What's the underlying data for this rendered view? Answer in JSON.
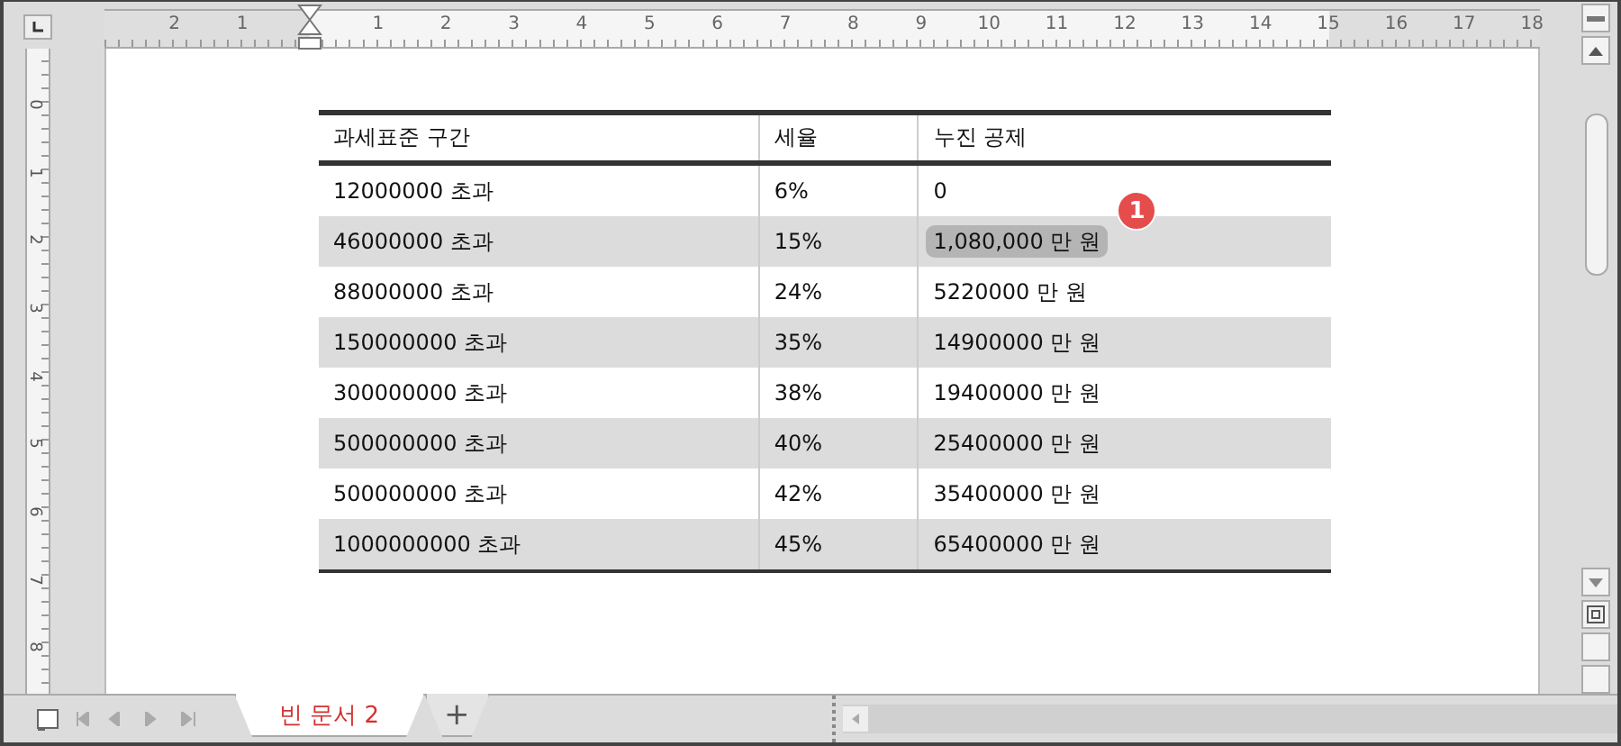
{
  "ruler": {
    "left_labels": [
      "2",
      "1"
    ],
    "labels": [
      "1",
      "2",
      "3",
      "4",
      "5",
      "6",
      "7",
      "8",
      "9",
      "10",
      "11",
      "12",
      "13",
      "14",
      "15",
      "16",
      "17",
      "18"
    ]
  },
  "vertical_ruler": {
    "labels": [
      "0",
      "1",
      "2",
      "3",
      "4",
      "5",
      "6",
      "7",
      "8"
    ]
  },
  "table": {
    "columns": [
      "과세표준 구간",
      "세율",
      "누진 공제"
    ],
    "rows": [
      {
        "bracket": "12000000 초과",
        "rate": "6%",
        "deduction": "0",
        "shaded": false,
        "highlighted": false
      },
      {
        "bracket": "46000000 초과",
        "rate": "15%",
        "deduction": "1,080,000 만 원",
        "shaded": true,
        "highlighted": true,
        "callout": "1"
      },
      {
        "bracket": "88000000 초과",
        "rate": "24%",
        "deduction": "5220000 만 원",
        "shaded": false,
        "highlighted": false
      },
      {
        "bracket": "150000000 초과",
        "rate": "35%",
        "deduction": "14900000 만 원",
        "shaded": true,
        "highlighted": false
      },
      {
        "bracket": "300000000 초과",
        "rate": "38%",
        "deduction": "19400000 만 원",
        "shaded": false,
        "highlighted": false
      },
      {
        "bracket": "500000000 초과",
        "rate": "40%",
        "deduction": "25400000 만 원",
        "shaded": true,
        "highlighted": false
      },
      {
        "bracket": "500000000 초과",
        "rate": "42%",
        "deduction": "35400000 만 원",
        "shaded": false,
        "highlighted": false
      },
      {
        "bracket": "1000000000 초과",
        "rate": "45%",
        "deduction": "65400000 만 원",
        "shaded": true,
        "highlighted": false
      }
    ]
  },
  "tabs": [
    {
      "label": "빈 문서 2",
      "selected": true
    },
    {
      "label": "+",
      "selected": false
    }
  ]
}
